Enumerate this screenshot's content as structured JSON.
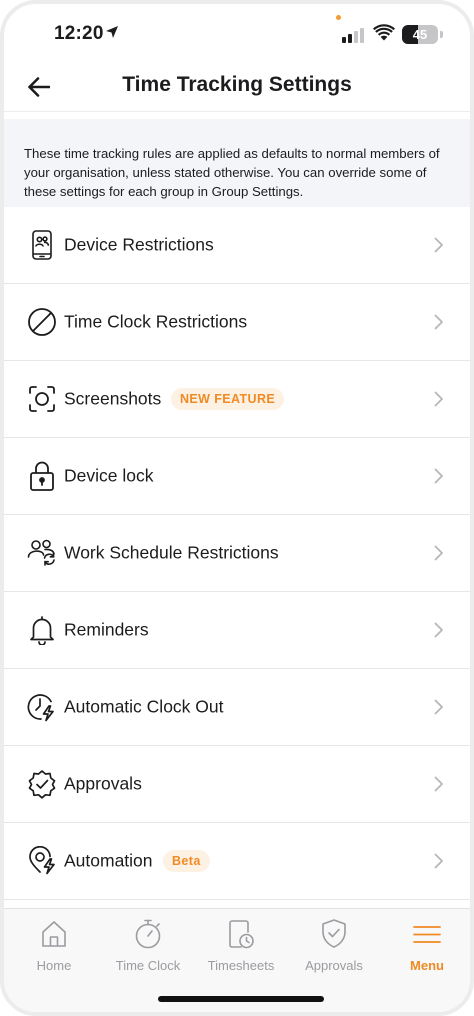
{
  "status_bar": {
    "time": "12:20",
    "battery_level": "45",
    "battery_fraction": 0.45,
    "signal_bars": 2,
    "signal_bars_total": 4
  },
  "header": {
    "title": "Time Tracking Settings"
  },
  "description": "These time tracking rules are applied as defaults to normal members of your organisation, unless stated otherwise. You can override some of these settings for each group in Group Settings.",
  "settings": {
    "items": [
      {
        "label": "Device Restrictions",
        "icon": "device-restrictions-icon",
        "badge": ""
      },
      {
        "label": "Time Clock Restrictions",
        "icon": "prohibited-icon",
        "badge": ""
      },
      {
        "label": "Screenshots",
        "icon": "screenshot-icon",
        "badge": "NEW FEATURE"
      },
      {
        "label": "Device lock",
        "icon": "lock-icon",
        "badge": ""
      },
      {
        "label": "Work Schedule Restrictions",
        "icon": "people-sync-icon",
        "badge": ""
      },
      {
        "label": "Reminders",
        "icon": "bell-icon",
        "badge": ""
      },
      {
        "label": "Automatic Clock Out",
        "icon": "clock-bolt-icon",
        "badge": ""
      },
      {
        "label": "Approvals",
        "icon": "check-badge-icon",
        "badge": ""
      },
      {
        "label": "Automation",
        "icon": "location-bolt-icon",
        "badge": "Beta"
      }
    ]
  },
  "tab_bar": {
    "tabs": [
      {
        "label": "Home",
        "icon": "home-icon",
        "active": false
      },
      {
        "label": "Time Clock",
        "icon": "stopwatch-icon",
        "active": false
      },
      {
        "label": "Timesheets",
        "icon": "timesheet-icon",
        "active": false
      },
      {
        "label": "Approvals",
        "icon": "shield-check-icon",
        "active": false
      },
      {
        "label": "Menu",
        "icon": "menu-icon",
        "active": true
      }
    ]
  },
  "colors": {
    "accent": "#f08a24",
    "badge_background": "#fdf1e4",
    "description_background": "#f4f5f9",
    "tab_inactive": "#9b9ba0",
    "text": "#1c1c1e"
  }
}
